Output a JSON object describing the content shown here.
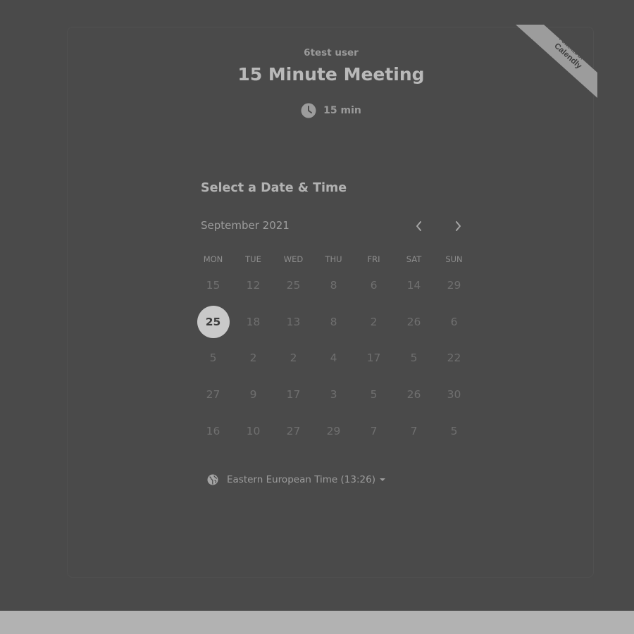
{
  "event": {
    "owner": "6test user",
    "title": "15 Minute Meeting",
    "duration": "15 min",
    "duration_icon": "clock-icon"
  },
  "badge": {
    "line1": "POWERED BY",
    "line2": "Calendly"
  },
  "calendar": {
    "heading": "Select a Date & Time",
    "month": "September 2021",
    "weekdays": [
      "MON",
      "TUE",
      "WED",
      "THU",
      "FRI",
      "SAT",
      "SUN"
    ],
    "weeks": [
      [
        "15",
        "12",
        "25",
        "8",
        "6",
        "14",
        "29"
      ],
      [
        "25",
        "18",
        "13",
        "8",
        "2",
        "26",
        "6"
      ],
      [
        "5",
        "2",
        "2",
        "4",
        "17",
        "5",
        "22"
      ],
      [
        "27",
        "9",
        "17",
        "3",
        "5",
        "26",
        "30"
      ],
      [
        "16",
        "10",
        "27",
        "29",
        "7",
        "7",
        "5"
      ]
    ],
    "selected_day": "25"
  },
  "timezone": {
    "label": "Eastern European Time (13:26)",
    "icon": "globe-icon"
  },
  "colors": {
    "background": "#4a4a4a",
    "selected_circle": "#c9c9c9",
    "bottom_bar": "#b2b2b2"
  }
}
